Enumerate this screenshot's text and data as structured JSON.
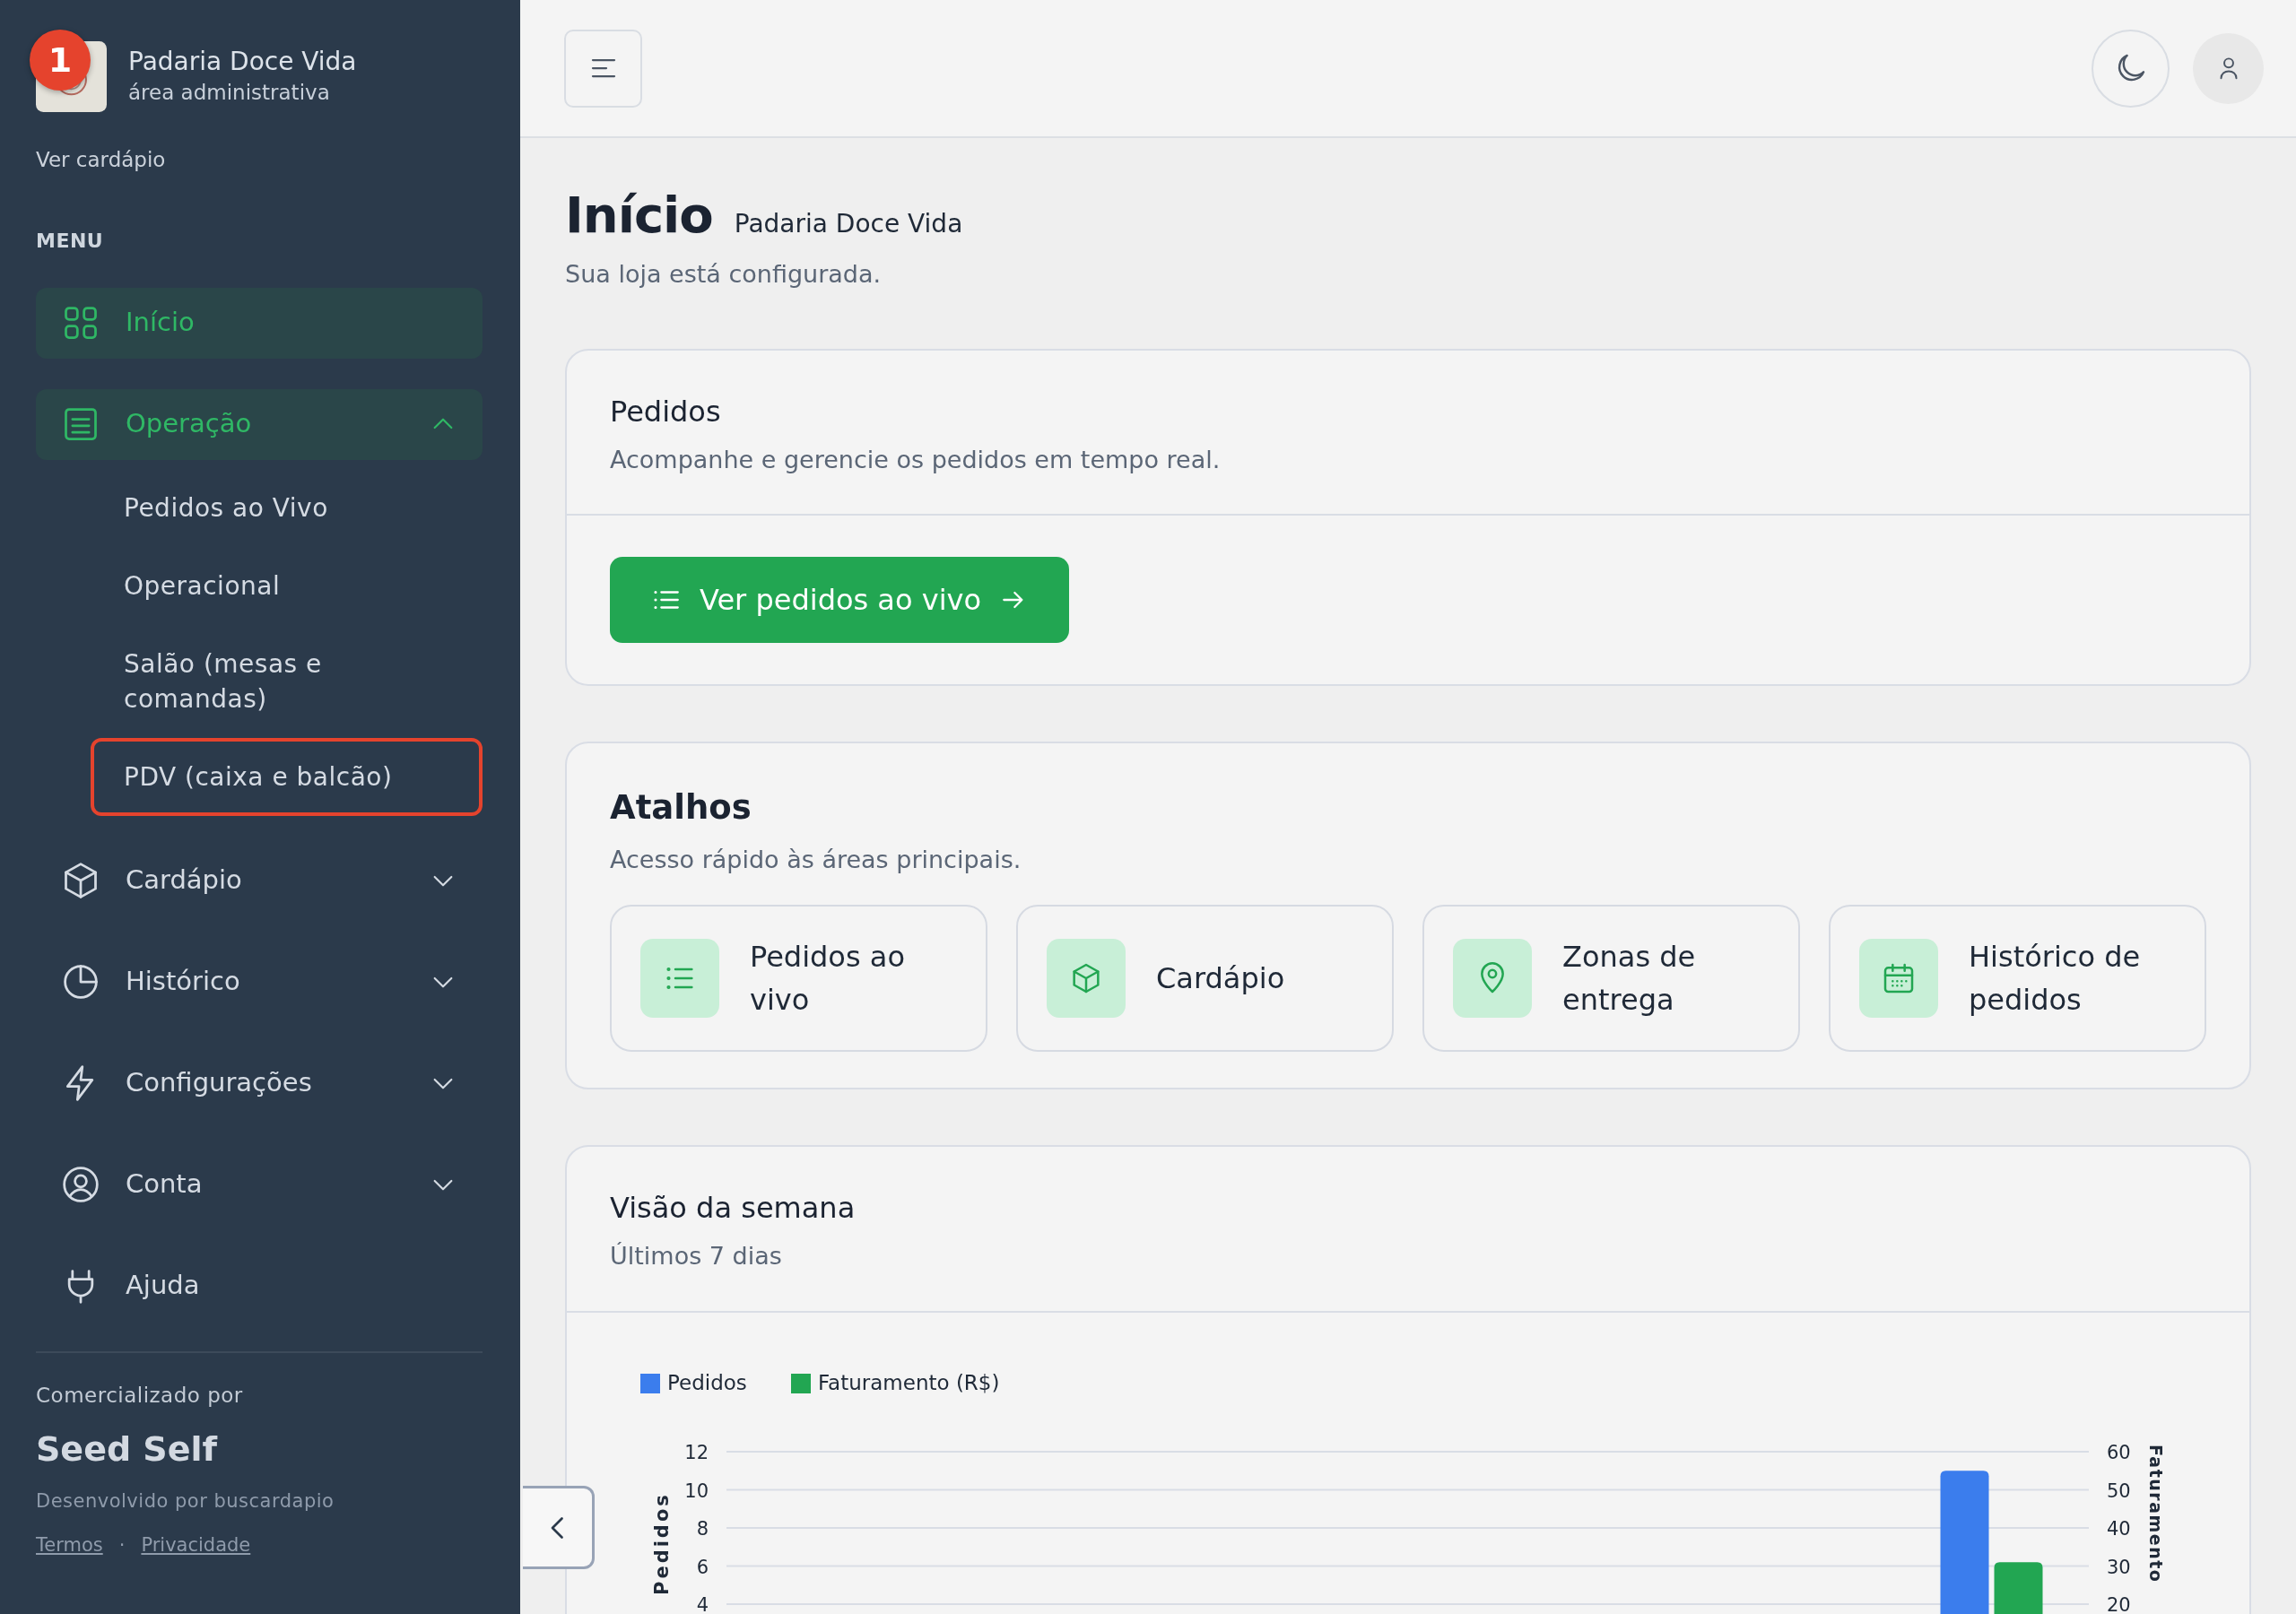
{
  "brand": {
    "name": "Padaria Doce Vida",
    "subtitle": "área administrativa"
  },
  "annotation": {
    "badge": "1"
  },
  "view_menu_link": "Ver cardápio",
  "menu_heading": "MENU",
  "menu": [
    {
      "label": "Início",
      "kind": "link",
      "selected": true
    },
    {
      "label": "Operação",
      "kind": "group",
      "selected": true,
      "expanded": true,
      "children": [
        {
          "label": "Pedidos ao Vivo",
          "highlighted": false
        },
        {
          "label": "Operacional",
          "highlighted": false
        },
        {
          "label": "Salão (mesas e comandas)",
          "highlighted": false
        },
        {
          "label": "PDV (caixa e balcão)",
          "highlighted": true
        }
      ]
    },
    {
      "label": "Cardápio",
      "kind": "group",
      "selected": false,
      "expanded": false
    },
    {
      "label": "Histórico",
      "kind": "group",
      "selected": false,
      "expanded": false
    },
    {
      "label": "Configurações",
      "kind": "group",
      "selected": false,
      "expanded": false
    },
    {
      "label": "Conta",
      "kind": "group",
      "selected": false,
      "expanded": false
    },
    {
      "label": "Ajuda",
      "kind": "link",
      "selected": false
    }
  ],
  "footer": {
    "marketed_by": "Comercializado por",
    "company": "Seed Self",
    "developed_by": "Desenvolvido por buscardapio",
    "links": [
      "Termos",
      "Privacidade"
    ],
    "separator": "·"
  },
  "page": {
    "title": "Início",
    "subtitle": "Padaria Doce Vida",
    "description": "Sua loja está configurada."
  },
  "orders_card": {
    "title": "Pedidos",
    "description": "Acompanhe e gerencie os pedidos em tempo real.",
    "button": "Ver pedidos ao vivo"
  },
  "shortcuts": {
    "title": "Atalhos",
    "description": "Acesso rápido às áreas principais.",
    "items": [
      "Pedidos ao vivo",
      "Cardápio",
      "Zonas de entrega",
      "Histórico de pedidos"
    ]
  },
  "week": {
    "title": "Visão da semana",
    "subtitle": "Últimos 7 dias",
    "chart_data": {
      "type": "bar",
      "grid": true,
      "legend": "top-left",
      "ylabel": "Pedidos",
      "y2label": "Faturamento",
      "ylim": [
        0,
        12
      ],
      "y2lim": [
        0,
        60
      ],
      "yticks": [
        4,
        6,
        8,
        10,
        12
      ],
      "y2ticks": [
        20,
        30,
        40,
        50,
        60
      ],
      "series": [
        {
          "name": "Pedidos",
          "color": "#3b7ded",
          "values": [
            0,
            0,
            0,
            0,
            0,
            0,
            11
          ]
        },
        {
          "name": "Faturamento (R$)",
          "color": "#22a652",
          "axis": "y2",
          "values": [
            0,
            0,
            0,
            0,
            0,
            0,
            31
          ]
        }
      ]
    }
  }
}
